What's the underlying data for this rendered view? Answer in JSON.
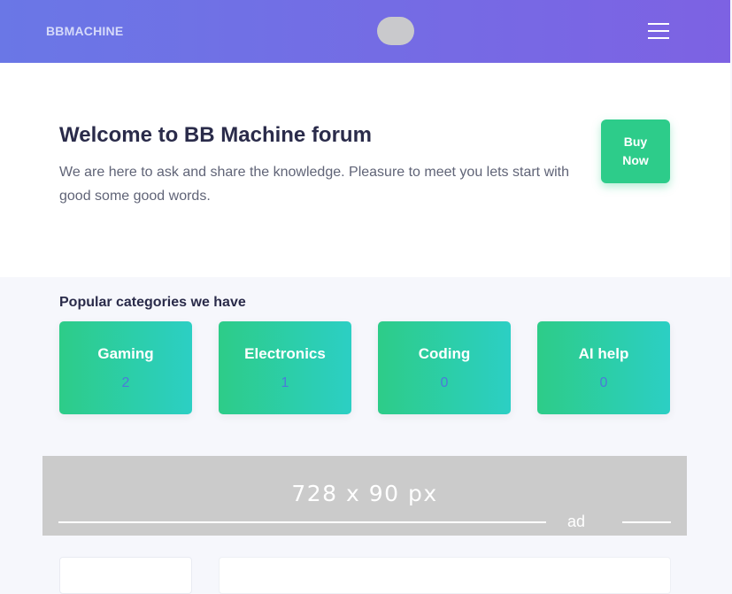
{
  "navbar": {
    "brand": "BBMACHINE",
    "menu_icon": "hamburger-menu-icon"
  },
  "hero": {
    "title": "Welcome to BB Machine forum",
    "text": "We are here to ask and share the knowledge. Pleasure to meet you lets start with good some good words.",
    "buy_button": "Buy Now"
  },
  "categories": {
    "title": "Popular categories we have",
    "items": [
      {
        "name": "Gaming",
        "count": "2"
      },
      {
        "name": "Electronics",
        "count": "1"
      },
      {
        "name": "Coding",
        "count": "0"
      },
      {
        "name": "AI help",
        "count": "0"
      }
    ]
  },
  "ad": {
    "size_text": "728 x 90 px",
    "label": "ad"
  },
  "colors": {
    "navbar_start": "#6a77e6",
    "navbar_end": "#7d62e3",
    "accent_green": "#2dcc8a",
    "card_gradient_end": "#2ccfc4",
    "count_blue": "#4b7bd8",
    "ad_background": "#cbcbcb"
  }
}
